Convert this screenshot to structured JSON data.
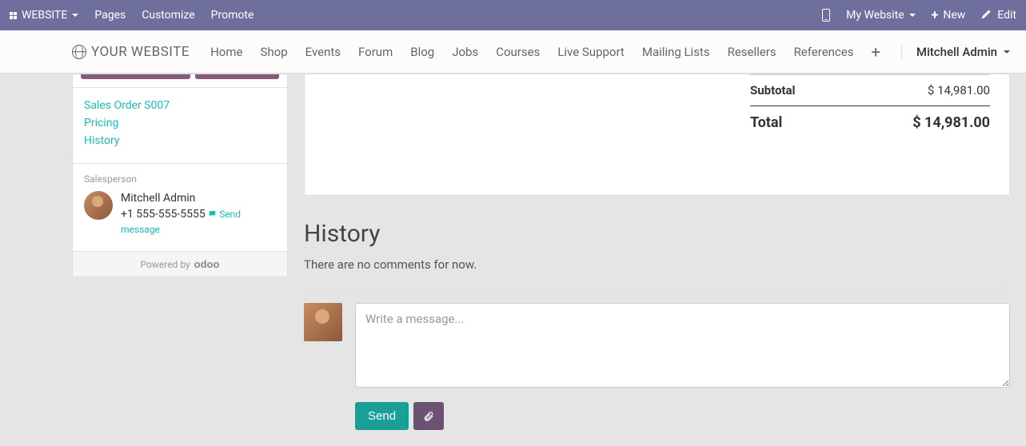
{
  "topbar": {
    "website_label": "WEBSITE",
    "pages": "Pages",
    "customize": "Customize",
    "promote": "Promote",
    "my_website": "My Website",
    "new": "New",
    "edit": "Edit"
  },
  "navbar": {
    "brand": "YOUR WEBSITE",
    "links": [
      "Home",
      "Shop",
      "Events",
      "Forum",
      "Blog",
      "Jobs",
      "Courses",
      "Live Support",
      "Mailing Lists",
      "Resellers",
      "References"
    ],
    "user": "Mitchell Admin"
  },
  "sidebar": {
    "links": {
      "order": "Sales Order S007",
      "pricing": "Pricing",
      "history": "History"
    },
    "salesperson_label": "Salesperson",
    "salesperson": {
      "name": "Mitchell Admin",
      "phone": "+1 555-555-5555",
      "send_message": "Send message"
    },
    "powered_by": "Powered by",
    "powered_brand": "odoo"
  },
  "order": {
    "subtotal_label": "Subtotal",
    "subtotal_value": "$ 14,981.00",
    "total_label": "Total",
    "total_value": "$ 14,981.00"
  },
  "history": {
    "title": "History",
    "empty": "There are no comments for now.",
    "placeholder": "Write a message...",
    "send": "Send"
  }
}
